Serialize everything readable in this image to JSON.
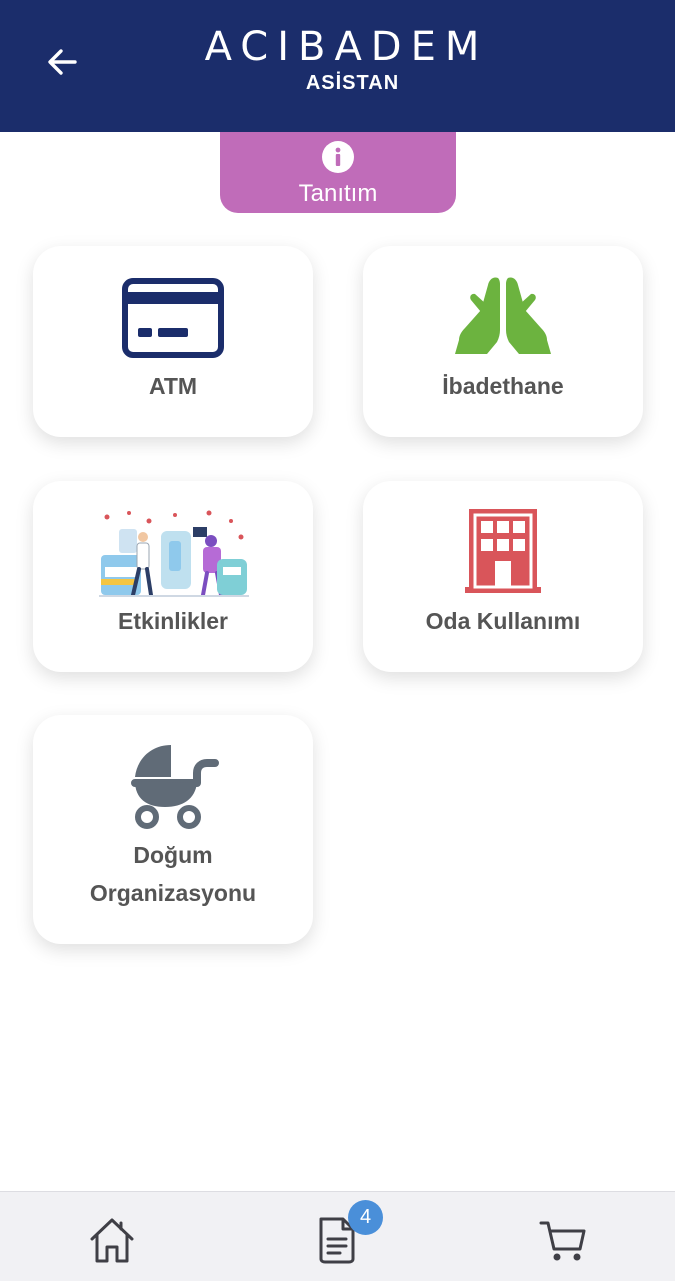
{
  "header": {
    "brand_name": "ACIBADEM",
    "brand_sub": "ASİSTAN",
    "back_icon": "arrow-left-icon"
  },
  "intro_tab": {
    "label": "Tanıtım",
    "icon": "info-icon"
  },
  "cards": [
    {
      "label": "ATM",
      "icon": "credit-card-icon",
      "color": "#1b2d6b"
    },
    {
      "label": "İbadethane",
      "icon": "praying-hands-icon",
      "color": "#6cb33f"
    },
    {
      "label": "Etkinlikler",
      "icon": "event-illustration-icon",
      "color": "#7b4ec0"
    },
    {
      "label": "Oda Kullanımı",
      "icon": "building-icon",
      "color": "#d9555a"
    },
    {
      "label_line1": "Doğum",
      "label_line2": "Organizasyonu",
      "icon": "baby-stroller-icon",
      "color": "#606b77"
    }
  ],
  "bottom_nav": {
    "items": [
      {
        "icon": "home-icon"
      },
      {
        "icon": "document-icon",
        "badge": "4"
      },
      {
        "icon": "cart-icon"
      }
    ],
    "badge_color": "#4a8fd9"
  },
  "colors": {
    "header_bg": "#1b2d6b",
    "intro_bg": "#c06cb9"
  }
}
